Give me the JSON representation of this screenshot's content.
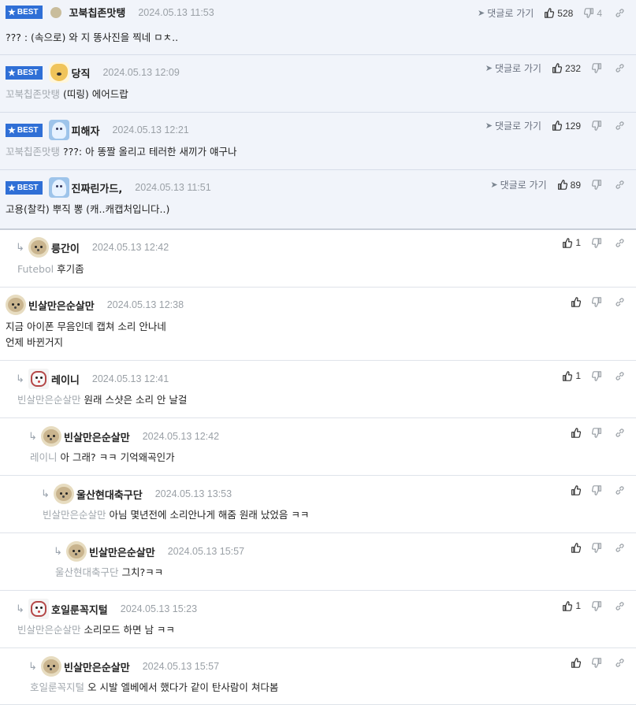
{
  "labels": {
    "best": "BEST",
    "goto": "댓글로 가기"
  },
  "comments": [
    {
      "best": true,
      "depth": 0,
      "avatar": "dot-avatar",
      "nick": "꼬북칩존맛탱",
      "date": "2024.05.13 11:53",
      "reply_to": "",
      "text": "??? : (속으로) 와 지 똥사진을 찍네 ㅁㅊ..",
      "goto": true,
      "up": "528",
      "down": "4"
    },
    {
      "best": true,
      "depth": 0,
      "avatar": "fox-avatar",
      "nick": "당직",
      "date": "2024.05.13 12:09",
      "reply_to": "꼬북칩존맛탱",
      "text": "(띠링) 에어드랍",
      "goto": true,
      "up": "232",
      "down": ""
    },
    {
      "best": true,
      "depth": 0,
      "avatar": "ghost-avatar",
      "nick": "피해자",
      "date": "2024.05.13 12:21",
      "reply_to": "꼬북칩존맛탱",
      "text": "???: 아 똥짤 올리고 테러한 새끼가 얘구나",
      "goto": true,
      "up": "129",
      "down": ""
    },
    {
      "best": true,
      "depth": 0,
      "avatar": "ghost-avatar",
      "nick": "진짜린가드,",
      "date": "2024.05.13 11:51",
      "reply_to": "",
      "text": "고용(찰칵) 뿌직 뽕 (캐..캐캡처입니다..)",
      "goto": true,
      "up": "89",
      "down": ""
    },
    {
      "best": false,
      "depth": 1,
      "avatar": "seal-avatar",
      "nick": "릉간이",
      "date": "2024.05.13 12:42",
      "reply_to": "Futebol",
      "text": "후기좀",
      "goto": false,
      "up": "1",
      "down": ""
    },
    {
      "best": false,
      "depth": 0,
      "avatar": "seal-avatar",
      "nick": "빈살만은순살만",
      "date": "2024.05.13 12:38",
      "reply_to": "",
      "text": "지금 아이폰 무음인데 캡쳐 소리 안나네\n언제 바뀐거지",
      "goto": false,
      "up": "",
      "down": ""
    },
    {
      "best": false,
      "depth": 1,
      "avatar": "dog-avatar",
      "nick": "레이니",
      "date": "2024.05.13 12:41",
      "reply_to": "빈살만은순살만",
      "text": "원래 스샷은 소리 안 날걸",
      "goto": false,
      "up": "1",
      "down": ""
    },
    {
      "best": false,
      "depth": 2,
      "avatar": "seal-avatar",
      "nick": "빈살만은순살만",
      "date": "2024.05.13 12:42",
      "reply_to": "레이니",
      "text": "아 그래? ㅋㅋ 기억왜곡인가",
      "goto": false,
      "up": "",
      "down": ""
    },
    {
      "best": false,
      "depth": 3,
      "avatar": "seal-avatar",
      "nick": "울산현대축구단",
      "date": "2024.05.13 13:53",
      "reply_to": "빈살만은순살만",
      "text": "아님 몇년전에 소리안나게 해줌 원래 났었음 ㅋㅋ",
      "goto": false,
      "up": "",
      "down": ""
    },
    {
      "best": false,
      "depth": 4,
      "avatar": "seal-avatar",
      "nick": "빈살만은순살만",
      "date": "2024.05.13 15:57",
      "reply_to": "울산현대축구단",
      "text": "그치?ㅋㅋ",
      "goto": false,
      "up": "",
      "down": ""
    },
    {
      "best": false,
      "depth": 1,
      "avatar": "dog-avatar",
      "nick": "호일룬꼭지털",
      "date": "2024.05.13 15:23",
      "reply_to": "빈살만은순살만",
      "text": "소리모드 하면 남 ㅋㅋ",
      "goto": false,
      "up": "1",
      "down": ""
    },
    {
      "best": false,
      "depth": 2,
      "avatar": "seal-avatar",
      "nick": "빈살만은순살만",
      "date": "2024.05.13 15:57",
      "reply_to": "호일룬꼭지털",
      "text": "오 시발 엘베에서 했다가 같이 탄사람이 쳐다봄",
      "goto": false,
      "up": "",
      "down": ""
    }
  ]
}
